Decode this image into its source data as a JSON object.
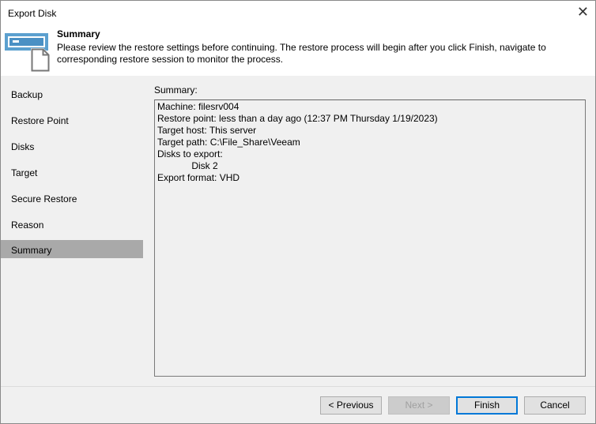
{
  "window": {
    "title": "Export Disk"
  },
  "header": {
    "title": "Summary",
    "description": "Please review the restore settings before continuing. The restore process will begin after you click Finish, navigate to corresponding restore session to monitor the process."
  },
  "nav": {
    "items": [
      {
        "label": "Backup"
      },
      {
        "label": "Restore Point"
      },
      {
        "label": "Disks"
      },
      {
        "label": "Target"
      },
      {
        "label": "Secure Restore"
      },
      {
        "label": "Reason"
      },
      {
        "label": "Summary",
        "selected": true
      }
    ]
  },
  "main": {
    "summary_label": "Summary:",
    "summary_text": "Machine: filesrv004\nRestore point: less than a day ago (12:37 PM Thursday 1/19/2023)\nTarget host: This server\nTarget path: C:\\File_Share\\Veeam\nDisks to export:\n             Disk 2\nExport format: VHD"
  },
  "footer": {
    "previous": "< Previous",
    "next": "Next >",
    "finish": "Finish",
    "cancel": "Cancel"
  },
  "colors": {
    "accent": "#0078d7",
    "selected": "#a9a9a9",
    "icon": "#4a90c4"
  }
}
